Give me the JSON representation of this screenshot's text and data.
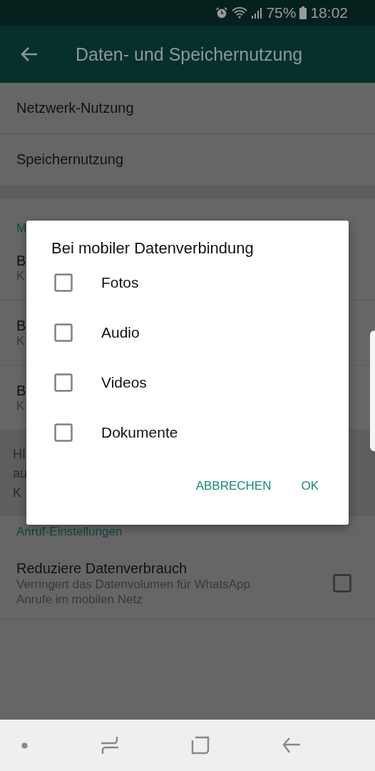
{
  "status_bar": {
    "battery_text": "75%",
    "time": "18:02"
  },
  "toolbar": {
    "title": "Daten- und Speichernutzung"
  },
  "items": [
    {
      "label": "Netzwerk-Nutzung"
    },
    {
      "label": "Speichernutzung"
    }
  ],
  "media_section": {
    "header": "M",
    "rows": [
      {
        "title": "B",
        "subtitle": "K"
      },
      {
        "title": "B",
        "subtitle": "K"
      },
      {
        "title": "B",
        "subtitle": "K"
      }
    ],
    "note": [
      "HI",
      "au",
      "K"
    ]
  },
  "call_section": {
    "header": "Anruf-Einstellungen",
    "setting": {
      "title": "Reduziere Datenverbrauch",
      "subtitle": "Verringert das Datenvolumen für WhatsApp Anrufe im mobilen Netz",
      "checked": false
    }
  },
  "dialog": {
    "title": "Bei mobiler Datenverbindung",
    "options": [
      {
        "label": "Fotos",
        "checked": false
      },
      {
        "label": "Audio",
        "checked": false
      },
      {
        "label": "Videos",
        "checked": false
      },
      {
        "label": "Dokumente",
        "checked": false
      }
    ],
    "buttons": [
      "ABBRECHEN",
      "OK"
    ]
  }
}
